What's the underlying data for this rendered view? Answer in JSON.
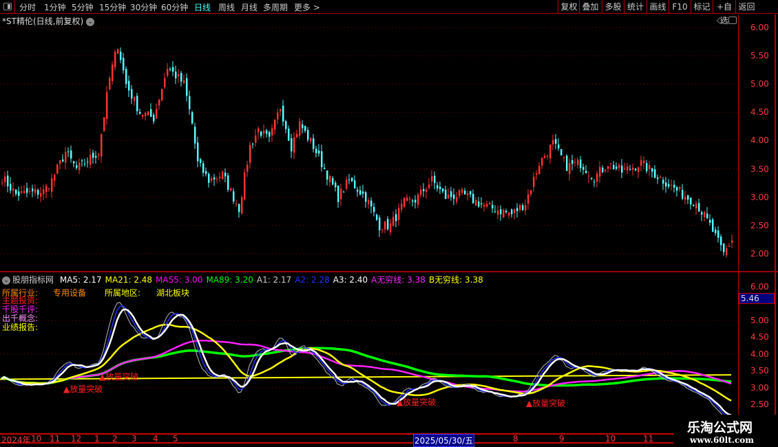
{
  "toolbar": {
    "periods": [
      "分时",
      "1分钟",
      "5分钟",
      "15分钟",
      "30分钟",
      "60分钟",
      "日线",
      "周线",
      "月线",
      "多周期",
      "更多 >"
    ],
    "active_period": "日线",
    "buttons": [
      "复权",
      "叠加",
      "多股",
      "统计",
      "画线",
      "F10",
      "标记",
      "+自选",
      "返回"
    ]
  },
  "title": "*ST精伦(日线,前复权)",
  "price_axis": [
    "6.00",
    "5.50",
    "5.00",
    "4.50",
    "4.00",
    "3.50",
    "3.00",
    "2.50",
    "2.00"
  ],
  "indicator": {
    "name": "股朋指标网",
    "values": [
      {
        "label": "MA5: 2.17",
        "color": "#ffffff"
      },
      {
        "label": "MA21: 2.48",
        "color": "#ffff00"
      },
      {
        "label": "MA55: 3.00",
        "color": "#ff00ff"
      },
      {
        "label": "MA89: 3.20",
        "color": "#00ff00"
      },
      {
        "label": "A1: 2.17",
        "color": "#cccccc"
      },
      {
        "label": "A2: 2.28",
        "color": "#2233ff"
      },
      {
        "label": "A3: 2.40",
        "color": "#ffffff"
      },
      {
        "label": "A无穷线: 3.38",
        "color": "#ff22ff"
      },
      {
        "label": "B无穷线: 3.38",
        "color": "#ffff00"
      }
    ],
    "info": {
      "industry_label": "所属行业:",
      "industry": "专用设备",
      "region_label": "所属地区:",
      "region": "湖北板块",
      "theme_label": "主题投资:",
      "review_label": "千股千评:",
      "concept_label": "出千概念:",
      "report_label": "业绩报告:"
    },
    "axis": [
      "6.00",
      "5.00",
      "4.50",
      "4.00",
      "3.50",
      "3.00",
      "2.50"
    ],
    "cursor_value": "5.46",
    "signal_label": "▲放量突破"
  },
  "date_axis": [
    "2024年",
    "10",
    "11",
    "12",
    "1",
    "2",
    "3",
    "4",
    "5",
    "8",
    "9",
    "10",
    "11"
  ],
  "current_date": "2025/05/30/五",
  "watermark": {
    "name": "乐淘公式网",
    "url": "www.60lt.com"
  },
  "chart_data": {
    "type": "candlestick",
    "ylim": [
      2.0,
      6.0
    ],
    "close_path": [
      [
        0,
        3.35
      ],
      [
        5,
        3.05
      ],
      [
        15,
        3.1
      ],
      [
        18,
        3.3
      ],
      [
        23,
        3.8
      ],
      [
        27,
        3.5
      ],
      [
        35,
        3.8
      ],
      [
        39,
        5.1
      ],
      [
        42,
        5.7
      ],
      [
        45,
        5.0
      ],
      [
        50,
        4.5
      ],
      [
        55,
        4.4
      ],
      [
        60,
        5.3
      ],
      [
        66,
        5.0
      ],
      [
        69,
        4.3
      ],
      [
        71,
        3.6
      ],
      [
        75,
        3.3
      ],
      [
        80,
        3.4
      ],
      [
        86,
        2.8
      ],
      [
        90,
        3.9
      ],
      [
        93,
        4.2
      ],
      [
        97,
        4.0
      ],
      [
        101,
        4.6
      ],
      [
        105,
        3.9
      ],
      [
        108,
        4.3
      ],
      [
        113,
        3.9
      ],
      [
        117,
        3.5
      ],
      [
        122,
        3.0
      ],
      [
        126,
        3.3
      ],
      [
        132,
        3.0
      ],
      [
        137,
        2.5
      ],
      [
        141,
        2.5
      ],
      [
        146,
        2.9
      ],
      [
        150,
        2.95
      ],
      [
        156,
        3.3
      ],
      [
        161,
        3.0
      ],
      [
        167,
        3.05
      ],
      [
        175,
        2.85
      ],
      [
        185,
        2.7
      ],
      [
        190,
        2.9
      ],
      [
        195,
        3.6
      ],
      [
        200,
        3.95
      ],
      [
        205,
        3.55
      ],
      [
        210,
        3.6
      ],
      [
        215,
        3.35
      ],
      [
        220,
        3.6
      ],
      [
        225,
        3.45
      ],
      [
        232,
        3.6
      ],
      [
        240,
        3.3
      ],
      [
        247,
        3.05
      ],
      [
        252,
        2.9
      ],
      [
        257,
        2.5
      ],
      [
        262,
        2.0
      ],
      [
        265,
        2.25
      ]
    ],
    "signals": [
      [
        23,
        "▲放量突破"
      ],
      [
        36,
        "▲放量突破"
      ],
      [
        144,
        "▲放量突破"
      ],
      [
        191,
        "▲放量突破"
      ]
    ]
  }
}
